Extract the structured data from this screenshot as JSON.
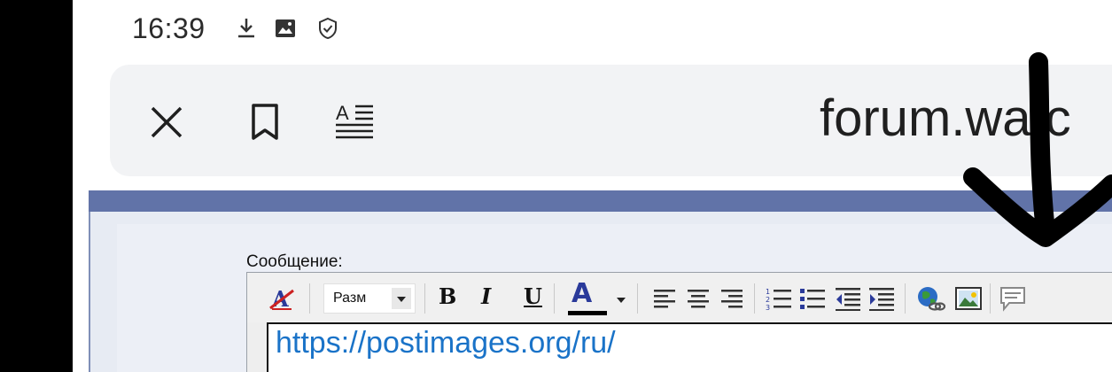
{
  "status": {
    "time": "16:39",
    "icons": [
      "download-icon",
      "image-icon",
      "shield-check-icon"
    ]
  },
  "browser": {
    "close_icon": "close-icon",
    "bookmark_icon": "bookmark-icon",
    "reader_icon": "reader-mode-icon",
    "url": "forum.watc"
  },
  "page": {
    "message_label": "Сообщение:",
    "editor": {
      "size_select_value": "Разм",
      "bold": "B",
      "italic": "I",
      "underline": "U",
      "font_color": "A",
      "textarea_value": "https://postimages.org/ru/"
    }
  },
  "colors": {
    "band_blue": "#6173a8",
    "link_blue": "#1a73c8",
    "panel_bg": "#e7ebf3"
  }
}
